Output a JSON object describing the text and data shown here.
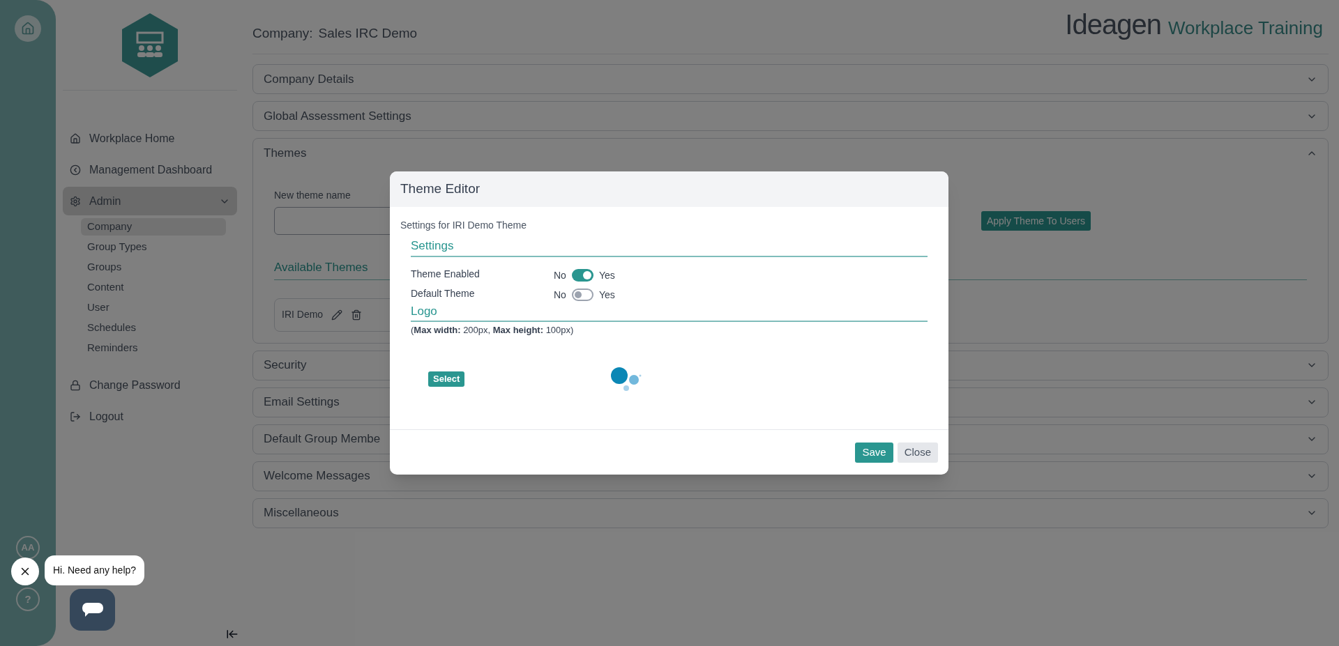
{
  "header": {
    "company_label": "Company:",
    "company_name": "Sales IRC Demo",
    "brand": "Ideagen",
    "product": "Workplace Training"
  },
  "rail": {
    "avatar": "AA",
    "help": "?"
  },
  "sidebar": {
    "items": [
      {
        "label": "Workplace Home",
        "selected": false
      },
      {
        "label": "Management Dashboard",
        "selected": false
      },
      {
        "label": "Admin",
        "selected": true,
        "expanded": true,
        "children": [
          {
            "label": "Company",
            "selected": true
          },
          {
            "label": "Group Types",
            "selected": false
          },
          {
            "label": "Groups",
            "selected": false
          },
          {
            "label": "Content",
            "selected": false
          },
          {
            "label": "User",
            "selected": false
          },
          {
            "label": "Schedules",
            "selected": false
          },
          {
            "label": "Reminders",
            "selected": false
          }
        ]
      },
      {
        "label": "Change Password",
        "selected": false
      },
      {
        "label": "Logout",
        "selected": false
      }
    ]
  },
  "sections": [
    {
      "title": "Company Details",
      "expanded": false
    },
    {
      "title": "Global Assessment Settings",
      "expanded": false
    },
    {
      "title": "Themes",
      "expanded": true
    },
    {
      "title": "Security",
      "expanded": false
    },
    {
      "title": "Email Settings",
      "expanded": false
    },
    {
      "title": "Default Group Membe",
      "expanded": false
    },
    {
      "title": "Welcome Messages",
      "expanded": false
    },
    {
      "title": "Miscellaneous",
      "expanded": false
    }
  ],
  "themes": {
    "new_theme_label": "New theme name",
    "apply_button": "Apply Theme To Users",
    "available_heading": "Available Themes",
    "items": [
      {
        "name": "IRI Demo"
      }
    ]
  },
  "dialog": {
    "title": "Theme Editor",
    "subtitle": "Settings for IRI Demo Theme",
    "settings_heading": "Settings",
    "toggles": [
      {
        "label": "Theme Enabled",
        "off_text": "No",
        "on_text": "Yes",
        "on": true
      },
      {
        "label": "Default Theme",
        "off_text": "No",
        "on_text": "Yes",
        "on": false
      }
    ],
    "logo_heading": "Logo",
    "logo_note": "(**Max width:** 200px,  **Max height:** 100px)",
    "select_button": "Select",
    "buttons": [
      {
        "label": "Save",
        "kind": "primary"
      },
      {
        "label": "Close",
        "kind": "secondary"
      }
    ]
  },
  "chat": {
    "message": "Hi. Need any help?"
  }
}
